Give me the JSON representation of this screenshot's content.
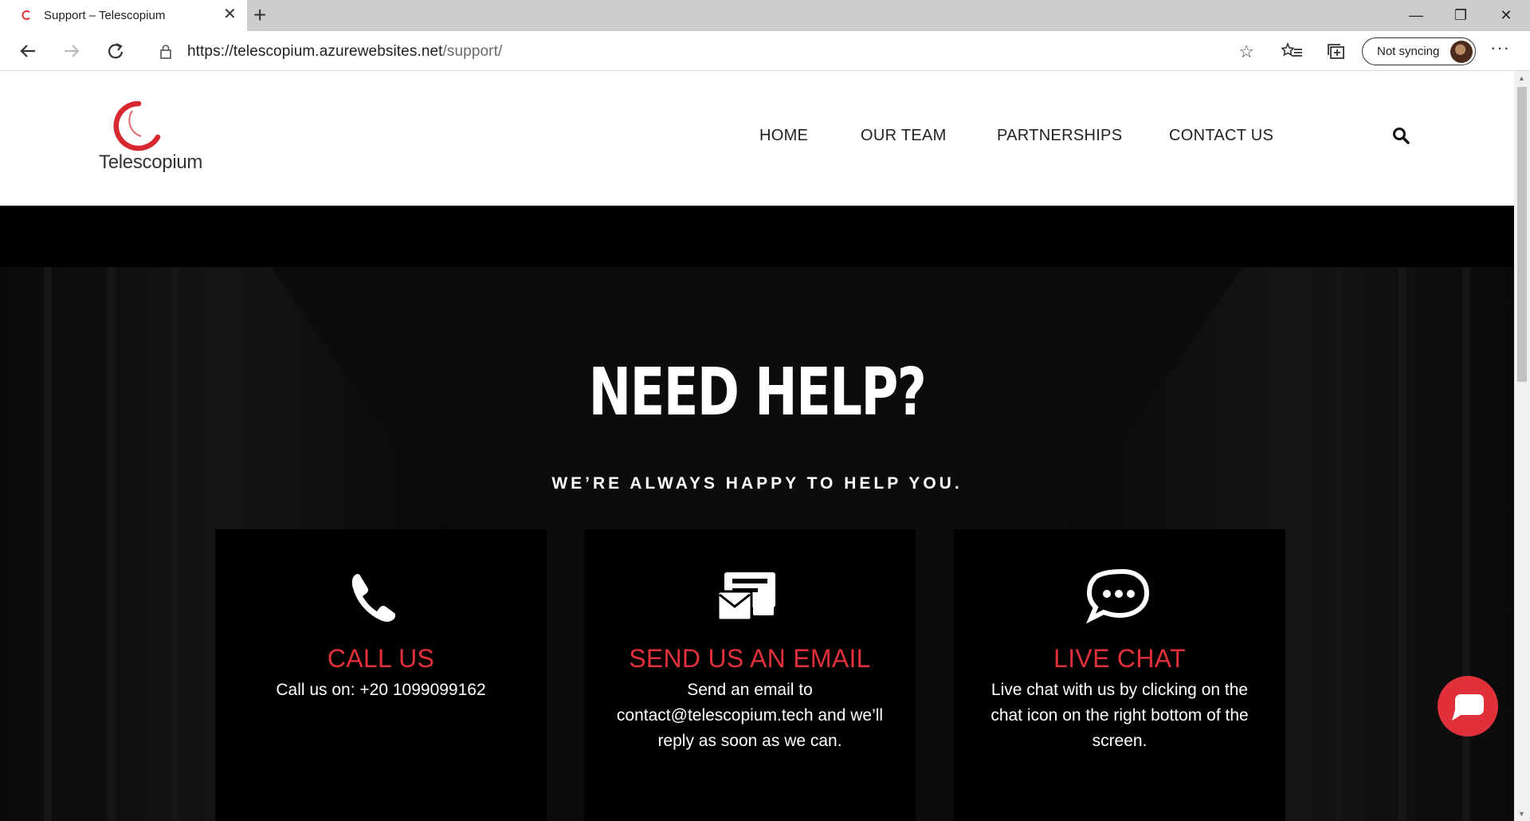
{
  "browser": {
    "tab_title": "Support – Telescopium",
    "url_host": "https://telescopium.azurewebsites.net",
    "url_path": "/support/",
    "sync_label": "Not syncing"
  },
  "site": {
    "logo_text": "Telescopium",
    "nav": [
      "HOME",
      "OUR TEAM",
      "PARTNERSHIPS",
      "CONTACT US"
    ]
  },
  "hero": {
    "title": "NEED HELP?",
    "subtitle": "WE’RE ALWAYS HAPPY TO HELP YOU."
  },
  "cards": [
    {
      "icon": "phone-icon",
      "title": "CALL US",
      "text": "Call us on: +20 1099099162"
    },
    {
      "icon": "email-icon",
      "title": "SEND US AN EMAIL",
      "text": "Send an email to contact@telescopium.tech and we’ll reply as soon as we can."
    },
    {
      "icon": "chat-icon",
      "title": "LIVE CHAT",
      "text": "Live chat with us by clicking on the chat icon on the right bottom of the screen."
    }
  ],
  "colors": {
    "accent": "#e0313b",
    "header_bg": "#ffffff",
    "page_bg": "#000000"
  }
}
